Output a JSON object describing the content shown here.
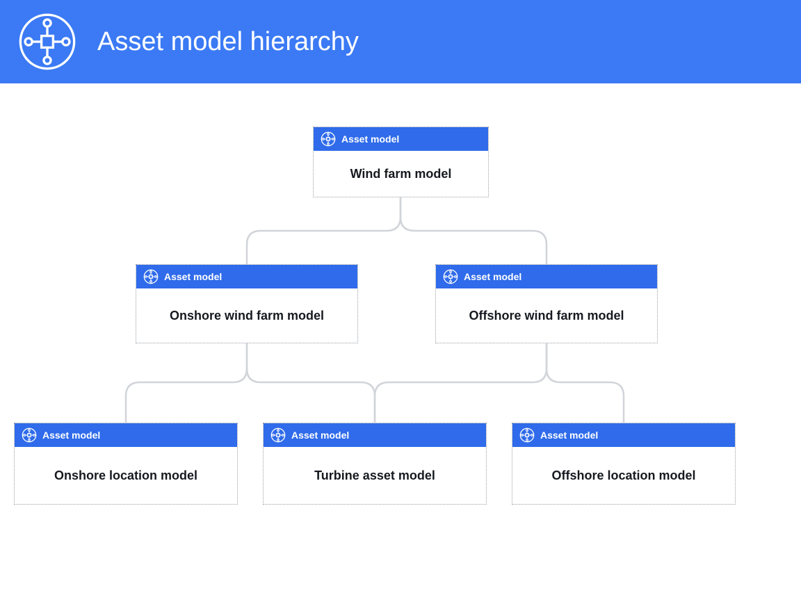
{
  "header": {
    "title": "Asset model hierarchy"
  },
  "labels": {
    "asset_model": "Asset model"
  },
  "colors": {
    "primary": "#3b7af4",
    "node_header": "#2f6bea",
    "connector": "#d1d4d9",
    "text": "#16191f"
  },
  "nodes": {
    "root": {
      "type_label": "Asset model",
      "title": "Wind farm model"
    },
    "onshore": {
      "type_label": "Asset model",
      "title": "Onshore wind farm model"
    },
    "offshore": {
      "type_label": "Asset model",
      "title": "Offshore wind farm model"
    },
    "onshore_location": {
      "type_label": "Asset model",
      "title": "Onshore location model"
    },
    "turbine": {
      "type_label": "Asset model",
      "title": "Turbine asset model"
    },
    "offshore_location": {
      "type_label": "Asset model",
      "title": "Offshore location model"
    }
  },
  "hierarchy": {
    "root": "root",
    "children": {
      "root": [
        "onshore",
        "offshore"
      ],
      "onshore": [
        "onshore_location",
        "turbine"
      ],
      "offshore": [
        "turbine",
        "offshore_location"
      ]
    }
  }
}
